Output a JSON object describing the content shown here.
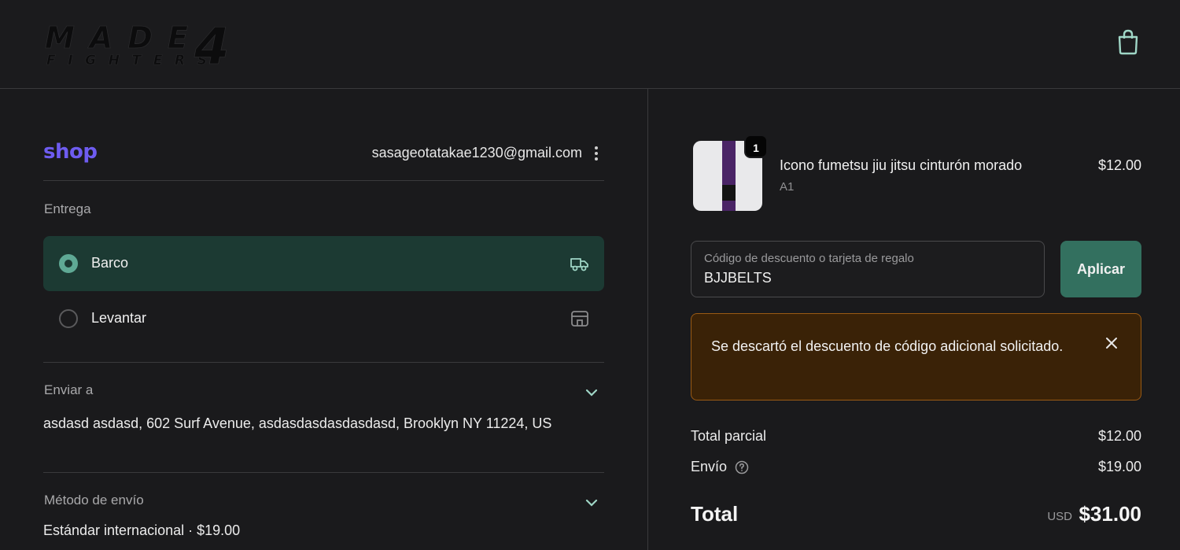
{
  "header": {
    "logo_text": "MADE4 FIGHTERS",
    "cart_icon": "shopping-bag-icon"
  },
  "account": {
    "shop_logo": "shop",
    "email": "sasageotatakae1230@gmail.com",
    "menu_icon": "kebab-menu-icon"
  },
  "delivery": {
    "label": "Entrega",
    "options": [
      {
        "label": "Barco",
        "selected": true,
        "icon": "truck-icon"
      },
      {
        "label": "Levantar",
        "selected": false,
        "icon": "store-icon"
      }
    ]
  },
  "ship_to": {
    "label": "Enviar a",
    "address": "asdasd asdasd, 602 Surf Avenue, asdasdasdasdasdasd, Brooklyn NY 11224, US"
  },
  "shipping_method": {
    "label": "Método de envío",
    "value": "Estándar internacional · $19.00"
  },
  "product": {
    "name": "Icono fumetsu jiu jitsu cinturón morado",
    "variant": "A1",
    "price": "$12.00",
    "quantity": "1"
  },
  "discount": {
    "placeholder": "Código de descuento o tarjeta de regalo",
    "value": "BJJBELTS",
    "apply_label": "Aplicar"
  },
  "alert": {
    "message": "Se descartó el descuento de código adicional solicitado."
  },
  "summary": {
    "subtotal_label": "Total parcial",
    "subtotal_value": "$12.00",
    "shipping_label": "Envío",
    "shipping_value": "$19.00",
    "total_label": "Total",
    "currency": "USD",
    "total_value": "$31.00"
  },
  "colors": {
    "background": "#1a1a1c",
    "accent": "#33705f",
    "selected_bg": "#1c3a33",
    "alert_bg": "#3a2207",
    "alert_border": "#9a5a14",
    "shop_purple": "#6e5cf0"
  }
}
